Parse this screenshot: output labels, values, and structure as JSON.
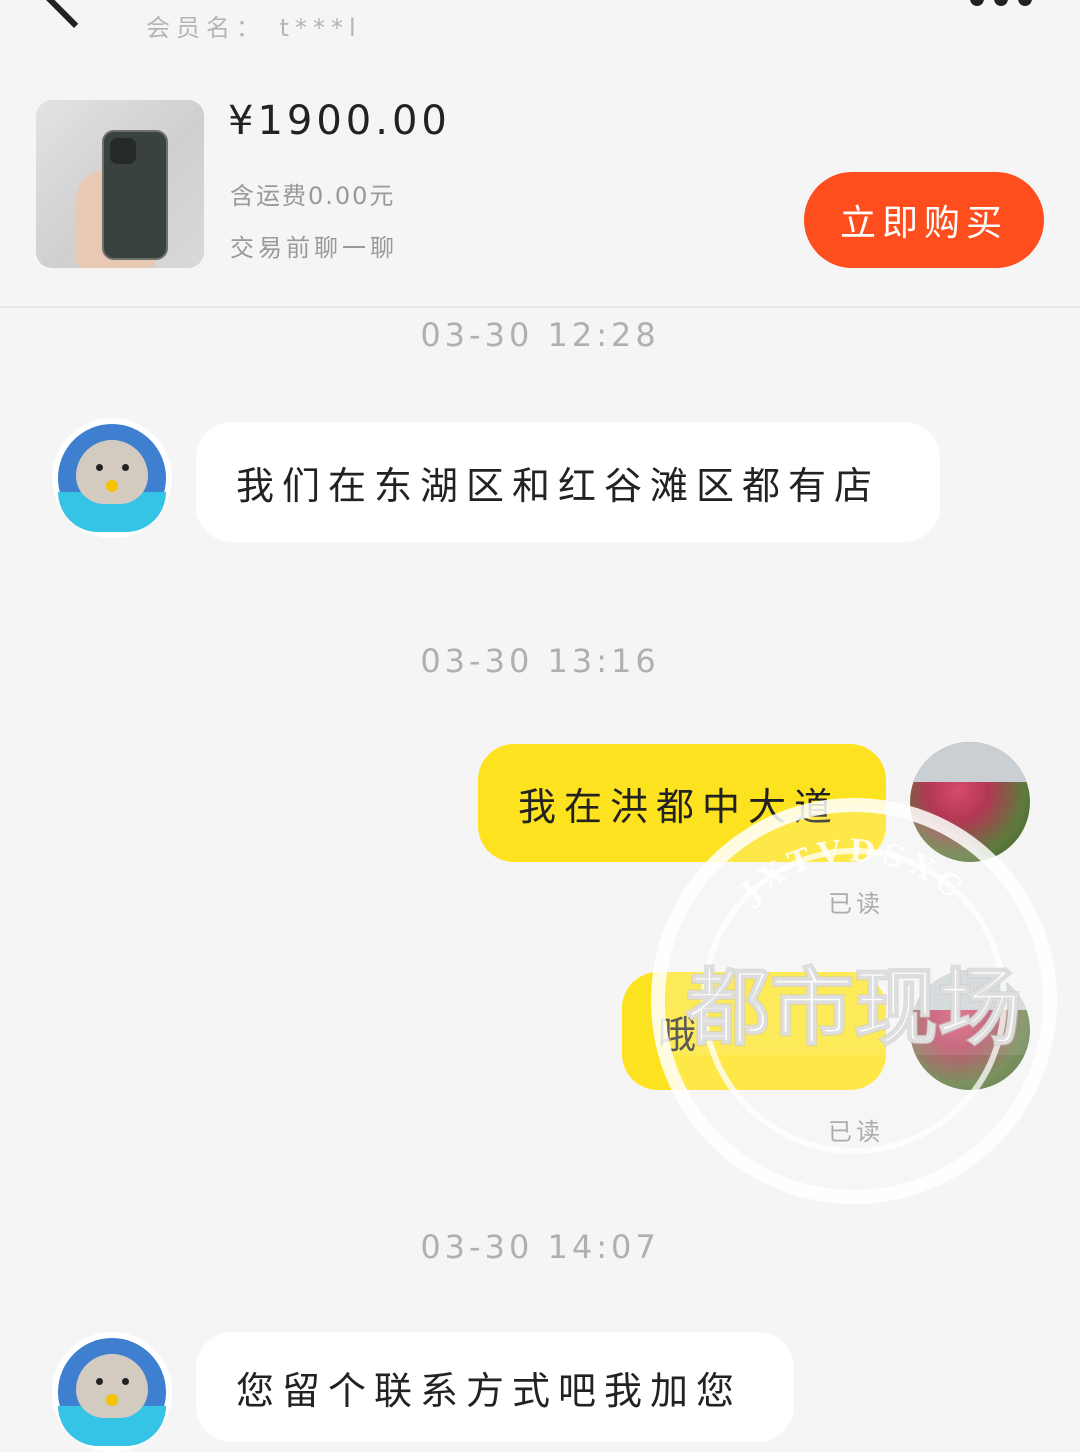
{
  "header": {
    "title_partial": "——————",
    "member_label": "会员名： t***l",
    "back_icon": "chevron-left-icon",
    "more_icon": "more-dots-icon"
  },
  "product": {
    "price": "¥1900.00",
    "shipping": "含运费0.00元",
    "note": "交易前聊一聊",
    "buy_label": "立即购买"
  },
  "messages": [
    {
      "kind": "timestamp",
      "text": "03-30 12:28"
    },
    {
      "kind": "incoming",
      "text": "我们在东湖区和红谷滩区都有店"
    },
    {
      "kind": "timestamp",
      "text": "03-30 13:16"
    },
    {
      "kind": "outgoing",
      "text": "我在洪都中大道",
      "status": "已读"
    },
    {
      "kind": "outgoing",
      "text": "哦",
      "status": "已读"
    },
    {
      "kind": "timestamp",
      "text": "03-30 14:07"
    },
    {
      "kind": "incoming",
      "text": "您留个联系方式吧我加您"
    }
  ],
  "watermark": {
    "arc_text": "JXTVDSXC",
    "main_text": "都市现场"
  },
  "colors": {
    "accent_buy": "#fe4e1d",
    "outgoing_bubble": "#fde31f",
    "incoming_bubble": "#ffffff",
    "background": "#f5f5f5"
  }
}
